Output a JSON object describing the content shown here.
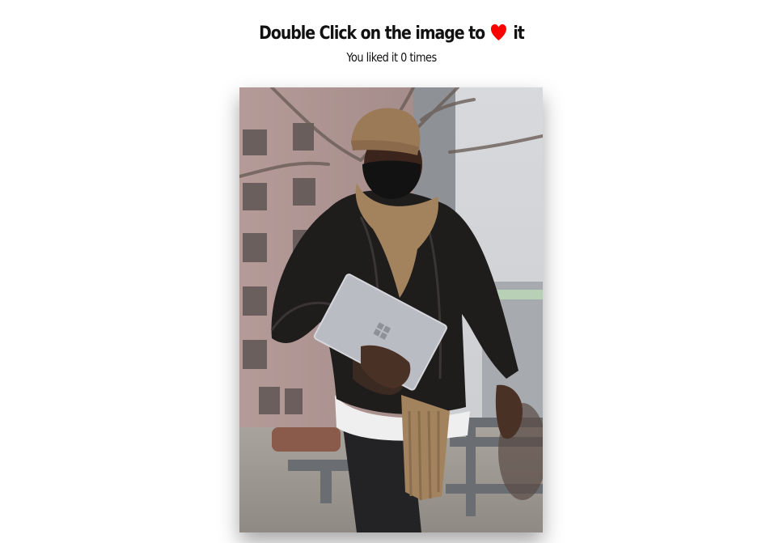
{
  "heading": {
    "text_before": "Double Click on the image to",
    "text_after": "it",
    "heart_color": "#ff0000",
    "heart_icon": "heart-icon"
  },
  "likes": {
    "prefix": "You liked it",
    "count": "0",
    "suffix": "times"
  }
}
